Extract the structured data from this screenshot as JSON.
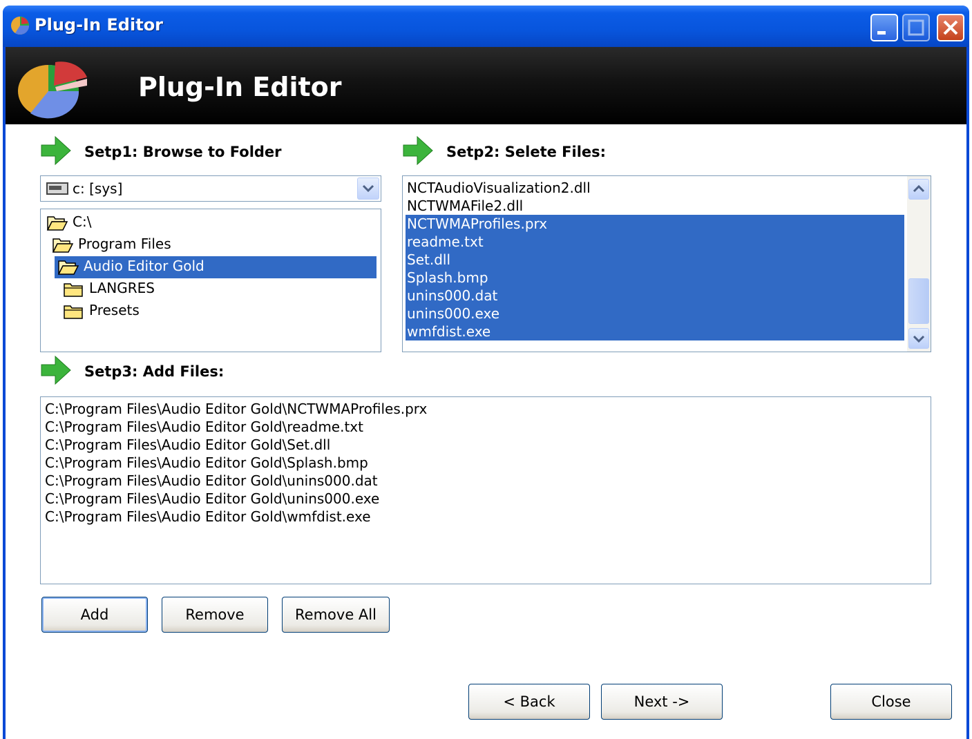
{
  "window": {
    "title": "Plug-In Editor",
    "icon": "pie-chart-icon"
  },
  "banner": {
    "heading": "Plug-In Editor",
    "logo": "pie-chart-logo"
  },
  "step1": {
    "label": "Setp1: Browse to Folder",
    "drive_value": "c: [sys]",
    "tree": [
      {
        "label": "C:\\",
        "icon": "open-folder-icon",
        "selected": false
      },
      {
        "label": "Program Files",
        "icon": "open-folder-icon",
        "selected": false
      },
      {
        "label": "Audio Editor Gold",
        "icon": "open-folder-icon",
        "selected": true
      },
      {
        "label": "LANGRES",
        "icon": "folder-icon",
        "selected": false
      },
      {
        "label": "Presets",
        "icon": "folder-icon",
        "selected": false
      }
    ]
  },
  "step2": {
    "label": "Setp2: Selete Files:",
    "files": [
      {
        "name": "NCTAudioVisualization2.dll",
        "selected": false
      },
      {
        "name": "NCTWMAFile2.dll",
        "selected": false
      },
      {
        "name": "NCTWMAProfiles.prx",
        "selected": true
      },
      {
        "name": "readme.txt",
        "selected": true
      },
      {
        "name": "Set.dll",
        "selected": true
      },
      {
        "name": "Splash.bmp",
        "selected": true
      },
      {
        "name": "unins000.dat",
        "selected": true
      },
      {
        "name": "unins000.exe",
        "selected": true
      },
      {
        "name": "wmfdist.exe",
        "selected": true
      }
    ]
  },
  "step3": {
    "label": "Setp3: Add Files:",
    "files": [
      "C:\\Program Files\\Audio Editor Gold\\NCTWMAProfiles.prx",
      "C:\\Program Files\\Audio Editor Gold\\readme.txt",
      "C:\\Program Files\\Audio Editor Gold\\Set.dll",
      "C:\\Program Files\\Audio Editor Gold\\Splash.bmp",
      "C:\\Program Files\\Audio Editor Gold\\unins000.dat",
      "C:\\Program Files\\Audio Editor Gold\\unins000.exe",
      "C:\\Program Files\\Audio Editor Gold\\wmfdist.exe"
    ]
  },
  "buttons": {
    "add": "Add",
    "remove": "Remove",
    "remove_all": "Remove All",
    "back": "< Back",
    "next": "Next ->",
    "close": "Close"
  },
  "colors": {
    "selection": "#316ac5",
    "titlebar": "#0855dd",
    "arrow": "#3cb43c"
  }
}
